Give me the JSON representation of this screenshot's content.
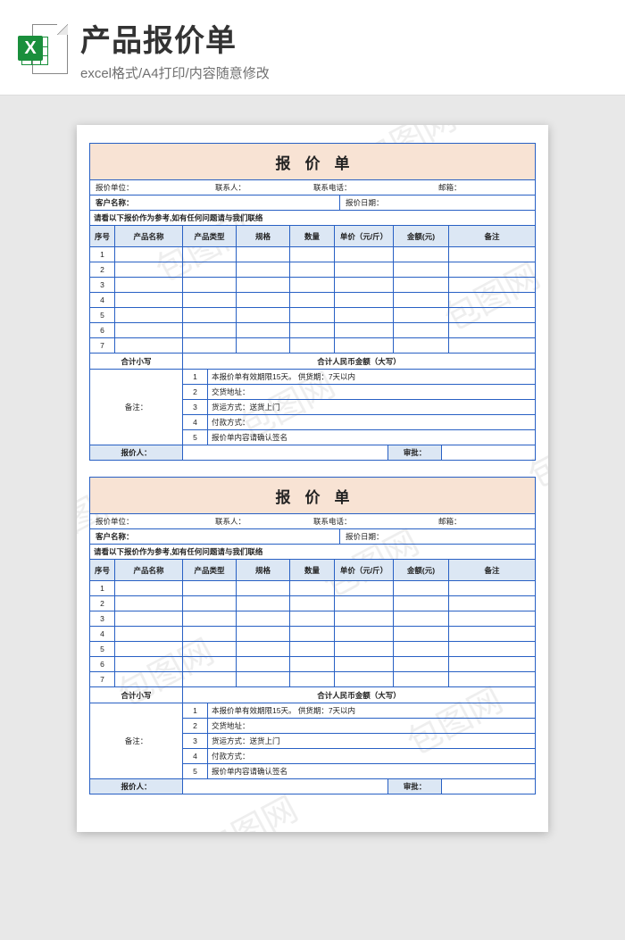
{
  "header": {
    "main_title": "产品报价单",
    "sub_title": "excel格式/A4打印/内容随意修改",
    "icon_letter": "X"
  },
  "watermark": "包图网",
  "form": {
    "title": "报价单",
    "info": {
      "quoter_unit_label": "报价单位：",
      "contact_label": "联系人：",
      "phone_label": "联系电话：",
      "email_label": "邮箱："
    },
    "customer": {
      "name_label": "客户名称：",
      "date_label": "报价日期："
    },
    "notice": "请看以下报价作为参考,如有任何问题请与我们联络",
    "columns": {
      "seq": "序号",
      "name": "产品名称",
      "type": "产品类型",
      "spec": "规格",
      "qty": "数量",
      "unit_price": "单价（元/斤）",
      "amount": "金额(元)",
      "note": "备注"
    },
    "rows": [
      "1",
      "2",
      "3",
      "4",
      "5",
      "6",
      "7"
    ],
    "sum": {
      "small_label": "合计小写",
      "big_label": "合计人民币金额（大写）"
    },
    "remarks": {
      "label": "备注：",
      "items": [
        {
          "n": "1",
          "text": "本报价单有效期限15天。    供货期：7天以内"
        },
        {
          "n": "2",
          "text": "交货地址："
        },
        {
          "n": "3",
          "text": "货运方式：送货上门"
        },
        {
          "n": "4",
          "text": "付款方式："
        },
        {
          "n": "5",
          "text": "报价单内容请确认签名"
        }
      ]
    },
    "sign": {
      "quoter_label": "报价人：",
      "approver_label": "审批："
    }
  }
}
